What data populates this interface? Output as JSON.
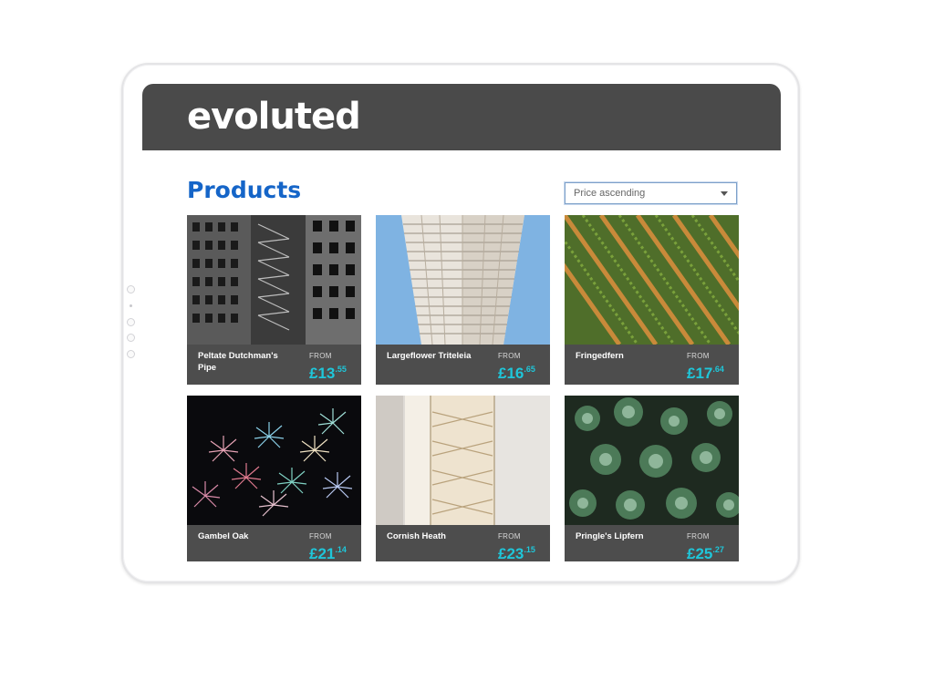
{
  "brand": {
    "logo_text": "evoluted"
  },
  "page": {
    "title": "Products"
  },
  "sort": {
    "selected": "Price ascending"
  },
  "colors": {
    "header_bg": "#4a4a4a",
    "title": "#1565c8",
    "price": "#1fc6d9",
    "card_footer": "#4d4d4d"
  },
  "products": [
    {
      "name": "Peltate Dutchman's Pipe",
      "from_label": "FROM",
      "price_main": "£13",
      "price_pence": ".55",
      "image": "black-and-white-building"
    },
    {
      "name": "Largeflower Triteleia",
      "from_label": "FROM",
      "price_main": "£16",
      "price_pence": ".65",
      "image": "tall-white-skyscraper"
    },
    {
      "name": "Fringedfern",
      "from_label": "FROM",
      "price_main": "£17",
      "price_pence": ".64",
      "image": "aerial-crop-rows"
    },
    {
      "name": "Gambel Oak",
      "from_label": "FROM",
      "price_main": "£21",
      "price_pence": ".14",
      "image": "fireworks"
    },
    {
      "name": "Cornish Heath",
      "from_label": "FROM",
      "price_main": "£23",
      "price_pence": ".15",
      "image": "staircase"
    },
    {
      "name": "Pringle's Lipfern",
      "from_label": "FROM",
      "price_main": "£25",
      "price_pence": ".27",
      "image": "succulent-plants"
    }
  ]
}
